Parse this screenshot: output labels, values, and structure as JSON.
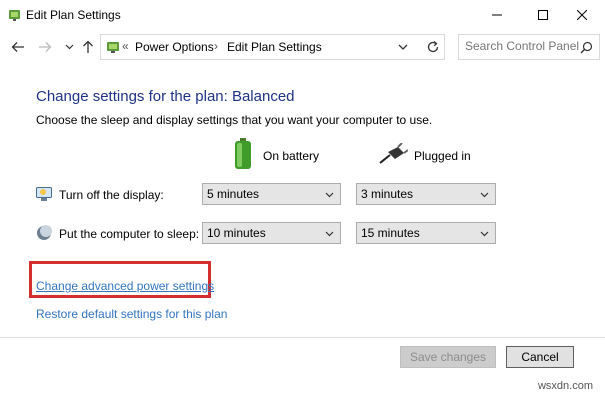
{
  "window": {
    "title": "Edit Plan Settings",
    "icons": [
      "power-plan-icon",
      "minimize-icon",
      "maximize-icon",
      "close-icon"
    ]
  },
  "address_bar": {
    "prefix": "«",
    "crumbs": [
      "Power Options",
      "Edit Plan Settings"
    ],
    "separator": "›",
    "search_placeholder": "Search Control Panel"
  },
  "content": {
    "heading": "Change settings for the plan: Balanced",
    "subtext": "Choose the sleep and display settings that you want your computer to use.",
    "columns": {
      "battery_label": "On battery",
      "plugged_label": "Plugged in"
    },
    "rows": [
      {
        "label": "Turn off the display:",
        "battery": "5 minutes",
        "plugged": "3 minutes"
      },
      {
        "label": "Put the computer to sleep:",
        "battery": "10 minutes",
        "plugged": "15 minutes"
      }
    ],
    "advanced_link": "Change advanced power settings",
    "restore_link": "Restore default settings for this plan"
  },
  "footer": {
    "save_label": "Save changes",
    "cancel_label": "Cancel"
  },
  "watermark": "wsxdn.com",
  "colors": {
    "heading": "#1e3287",
    "link": "#3274c2",
    "highlight_box": "#d32f2f"
  }
}
